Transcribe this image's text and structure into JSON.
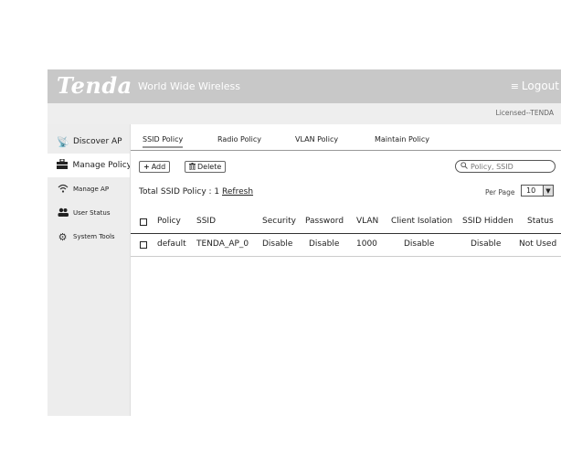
{
  "header": {
    "logo": "Tenda",
    "tagline": "World Wide Wireless",
    "logout_icon": "menu-icon",
    "logout_label": "Logout"
  },
  "subheader": {
    "licensed": "Licensed--TENDA"
  },
  "sidebar": {
    "items": [
      {
        "label": "Discover AP",
        "icon": "wifi-satellite-icon",
        "active": false
      },
      {
        "label": "Manage Policy",
        "icon": "briefcase-icon",
        "active": true
      },
      {
        "label": "Manage AP",
        "icon": "wifi-icon",
        "active": false
      },
      {
        "label": "User Status",
        "icon": "users-icon",
        "active": false
      },
      {
        "label": "System Tools",
        "icon": "gears-icon",
        "active": false
      }
    ]
  },
  "tabs": [
    {
      "label": "SSID Policy",
      "active": true
    },
    {
      "label": "Radio Policy",
      "active": false
    },
    {
      "label": "VLAN Policy",
      "active": false
    },
    {
      "label": "Maintain Policy",
      "active": false
    }
  ],
  "toolbar": {
    "add_icon": "+",
    "add_label": "Add",
    "delete_icon": "trash-icon",
    "delete_label": "Delete"
  },
  "search": {
    "placeholder": "Policy, SSID",
    "icon": "search-icon"
  },
  "summary": {
    "label": "Total SSID Policy :",
    "count": "1",
    "refresh": "Refresh"
  },
  "per_page": {
    "label": "Per Page",
    "value": "10"
  },
  "table": {
    "columns": [
      "Policy",
      "SSID",
      "Security",
      "Password",
      "VLAN",
      "Client Isolation",
      "SSID Hidden",
      "Status"
    ],
    "rows": [
      [
        "default",
        "TENDA_AP_0",
        "Disable",
        "Disable",
        "1000",
        "Disable",
        "Disable",
        "Not Used"
      ]
    ]
  },
  "colors": {
    "header_bg": "#c8c8c8",
    "sidebar_bg": "#ededed",
    "subheader_bg": "#eeeeee"
  }
}
